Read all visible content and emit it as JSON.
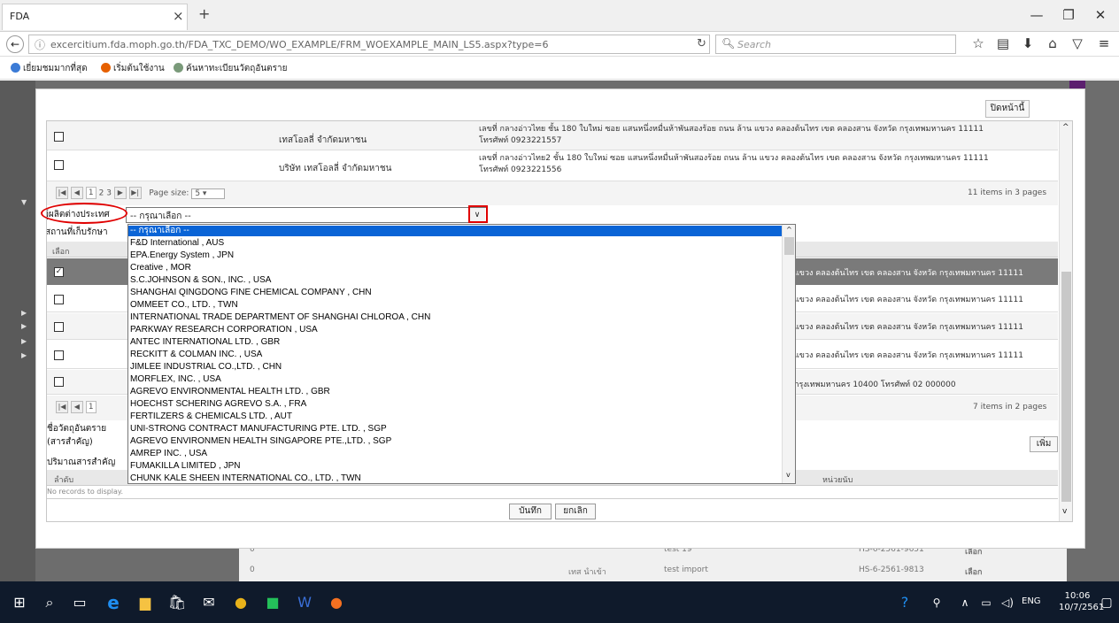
{
  "browser": {
    "tab_title": "FDA",
    "tab_close": "×",
    "new_tab": "+",
    "url": "excercitium.fda.moph.go.th/FDA_TXC_DEMO/WO_EXAMPLE/FRM_WOEXAMPLE_MAIN_LS5.aspx?type=6",
    "search_placeholder": "Search",
    "bookmarks": [
      "เยี่ยมชมมากที่สุด",
      "เริ่มต้นใช้งาน",
      "ค้นหาทะเบียนวัตถุอันตราย"
    ]
  },
  "modal": {
    "close_label": "ปิดหน้านี้",
    "top_table": {
      "rows": [
        {
          "name": "เทสโอลลี่ จำกัดมหาชน",
          "address": "เลขที่ กลางอ่าวไทย ชั้น 180 ใบใหม่ ซอย แสนหนึ่งหมื่นห้าพันสองร้อย ถนน ล้าน แขวง คลองต้นไทร เขต คลองสาน จังหวัด กรุงเทพมหานคร 11111",
          "phone": "โทรศัพท์ 0923221557"
        },
        {
          "name": "บริษัท เทสโอลลี่ จำกัดมหาชน",
          "address": "เลขที่ กลางอ่าวไทย2 ชั้น 180 ใบใหม่ ซอย แสนหนึ่งหมื่นห้าพันสองร้อย ถนน ล้าน แขวง คลองต้นไทร เขต คลองสาน จังหวัด กรุงเทพมหานคร 11111",
          "phone": "โทรศัพท์ 0923221556"
        }
      ],
      "pages": [
        "1",
        "2",
        "3"
      ],
      "page_size_label": "Page size:",
      "page_size": "5",
      "summary": "11 items in 3 pages"
    },
    "form": {
      "manufacturer_label": "ผู้ผลิตต่างประเทศ",
      "storage_label": "สถานที่เก็บรักษา",
      "select_value": "-- กรุณาเลือก --"
    },
    "second_table": {
      "header_select": "เลือก",
      "row_tails": [
        "แขวง คลองต้นไทร เขต คลองสาน จังหวัด กรุงเทพมหานคร 11111",
        "แขวง คลองต้นไทร เขต คลองสาน จังหวัด กรุงเทพมหานคร 11111",
        "แขวง คลองต้นไทร เขต คลองสาน จังหวัด กรุงเทพมหานคร 11111",
        "แขวง คลองต้นไทร เขต คลองสาน จังหวัด กรุงเทพมหานคร 11111",
        "กรุงเทพมหานคร 10400 โทรศัพท์ 02 000000"
      ],
      "summary": "7 items in 2 pages"
    },
    "hazard_label_1": "ชื่อวัตถุอันตราย",
    "hazard_label_2": "(สารสำคัญ)",
    "quantity_label": "ปริมาณสารสำคัญ",
    "add_button": "เพิ่ม",
    "grid_col_order": "ลำดับ",
    "grid_col_unit": "หน่วยนับ",
    "no_records": "No records to display.",
    "save_button": "บันทึก",
    "cancel_button": "ยกเลิก"
  },
  "dropdown_options": [
    "-- กรุณาเลือก --",
    "F&D International , AUS",
    "EPA.Energy System , JPN",
    "Creative , MOR",
    "S.C.JOHNSON & SON., INC. , USA",
    "SHANGHAI QINGDONG FINE CHEMICAL COMPANY , CHN",
    "OMMEET CO., LTD. , TWN",
    "INTERNATIONAL TRADE DEPARTMENT OF SHANGHAI CHLOROA , CHN",
    "PARKWAY RESEARCH CORPORATION , USA",
    "ANTEC INTERNATIONAL LTD. , GBR",
    "RECKITT & COLMAN INC. , USA",
    "JIMLEE INDUSTRIAL CO.,LTD. , CHN",
    "MORFLEX, INC. , USA",
    "AGREVO ENVIRONMENTAL HEALTH LTD. , GBR",
    "HOECHST SCHERING AGREVO S.A. , FRA",
    "FERTILZERS & CHEMICALS LTD. , AUT",
    "UNI-STRONG CONTRACT MANUFACTURING PTE. LTD. , SGP",
    "AGREVO ENVIRONMEN HEALTH SINGAPORE PTE.,LTD. , SGP",
    "AMREP INC. , USA",
    "FUMAKILLA LIMITED , JPN",
    "CHUNK KALE SHEEN INTERNATIONAL CO., LTD. , TWN"
  ],
  "background_table": {
    "row1": [
      "0",
      "test 19",
      "HS-6-2561-9651",
      "เลือก"
    ],
    "row2": [
      "0",
      "เทส นำเข้า",
      "test import",
      "HS-6-2561-9813",
      "เลือก"
    ]
  },
  "taskbar": {
    "time": "10:06",
    "date": "10/7/2561",
    "lang": "ENG"
  }
}
